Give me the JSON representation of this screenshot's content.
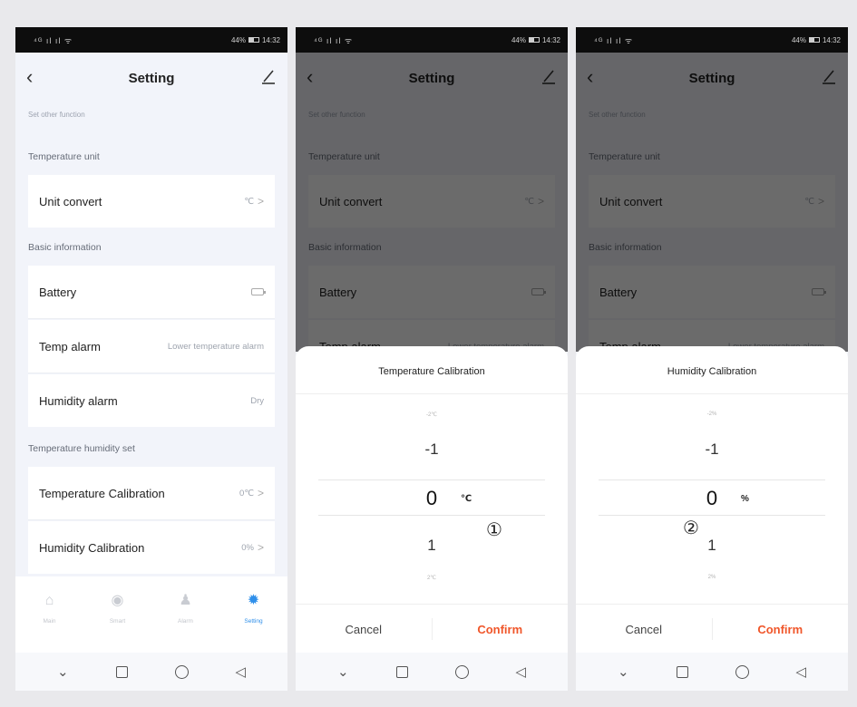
{
  "status": {
    "signal": "⁴ᴳ ıl ıl ᯤ",
    "battery_text": "44%",
    "time": "14:32"
  },
  "header": {
    "title": "Setting"
  },
  "subtitle": "Set other function",
  "sections": {
    "temperature_unit": "Temperature unit",
    "basic_info": "Basic information",
    "temp_humidity_set": "Temperature humidity set"
  },
  "rows": {
    "unit_convert": {
      "label": "Unit convert",
      "value": "℃"
    },
    "battery": {
      "label": "Battery"
    },
    "temp_alarm": {
      "label": "Temp alarm",
      "value": "Lower temperature alarm"
    },
    "humidity_alarm": {
      "label": "Humidity alarm",
      "value": "Dry"
    },
    "temp_calibration": {
      "label": "Temperature Calibration",
      "value": "0℃"
    },
    "humidity_calibration": {
      "label": "Humidity Calibration",
      "value": "0%"
    }
  },
  "chevron": ">",
  "tabs": [
    {
      "label": "Main",
      "icon": "home-icon"
    },
    {
      "label": "Smart",
      "icon": "smart-icon"
    },
    {
      "label": "Alarm",
      "icon": "bell-icon"
    },
    {
      "label": "Setting",
      "icon": "gear-icon",
      "active": true
    }
  ],
  "navbar": {
    "back_glyph": "◁",
    "down_glyph": "⌄"
  },
  "temp_dialog": {
    "title": "Temperature Calibration",
    "picker": {
      "above2": "-2℃",
      "above": "-1",
      "selected": "0",
      "below": "1",
      "below2": "2℃",
      "unit": "℃"
    },
    "marker": "①",
    "cancel": "Cancel",
    "confirm": "Confirm"
  },
  "humidity_dialog": {
    "title": "Humidity Calibration",
    "picker": {
      "above2": "-2%",
      "above": "-1",
      "selected": "0",
      "below": "1",
      "below2": "2%",
      "unit": "%"
    },
    "marker": "②",
    "cancel": "Cancel",
    "confirm": "Confirm"
  },
  "colors": {
    "accent": "#2f8fea",
    "confirm": "#f0562a",
    "background": "#f2f4fa"
  }
}
